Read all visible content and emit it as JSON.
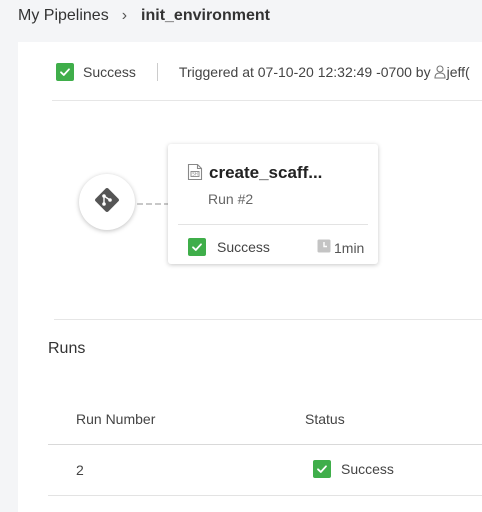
{
  "breadcrumb": {
    "parent": "My Pipelines",
    "separator": "›",
    "current": "init_environment"
  },
  "summary": {
    "status": "Success",
    "trigger_prefix": "Triggered at 07-10-20 12:32:49 -0700 by",
    "trigger_user": "jeff(",
    "user_icon": "user-icon"
  },
  "graph": {
    "trigger_icon": "git-icon",
    "job": {
      "name": "create_scaff...",
      "icon": "shell-script-icon",
      "run_label": "Run #2",
      "status": "Success",
      "duration": "1min",
      "duration_icon": "clock-icon"
    }
  },
  "runs": {
    "title": "Runs",
    "columns": [
      "Run Number",
      "Status"
    ],
    "rows": [
      {
        "run_number": "2",
        "status": "Success"
      }
    ]
  },
  "colors": {
    "success": "#3fae4a",
    "background": "#f4f5f7",
    "panel": "#ffffff"
  }
}
